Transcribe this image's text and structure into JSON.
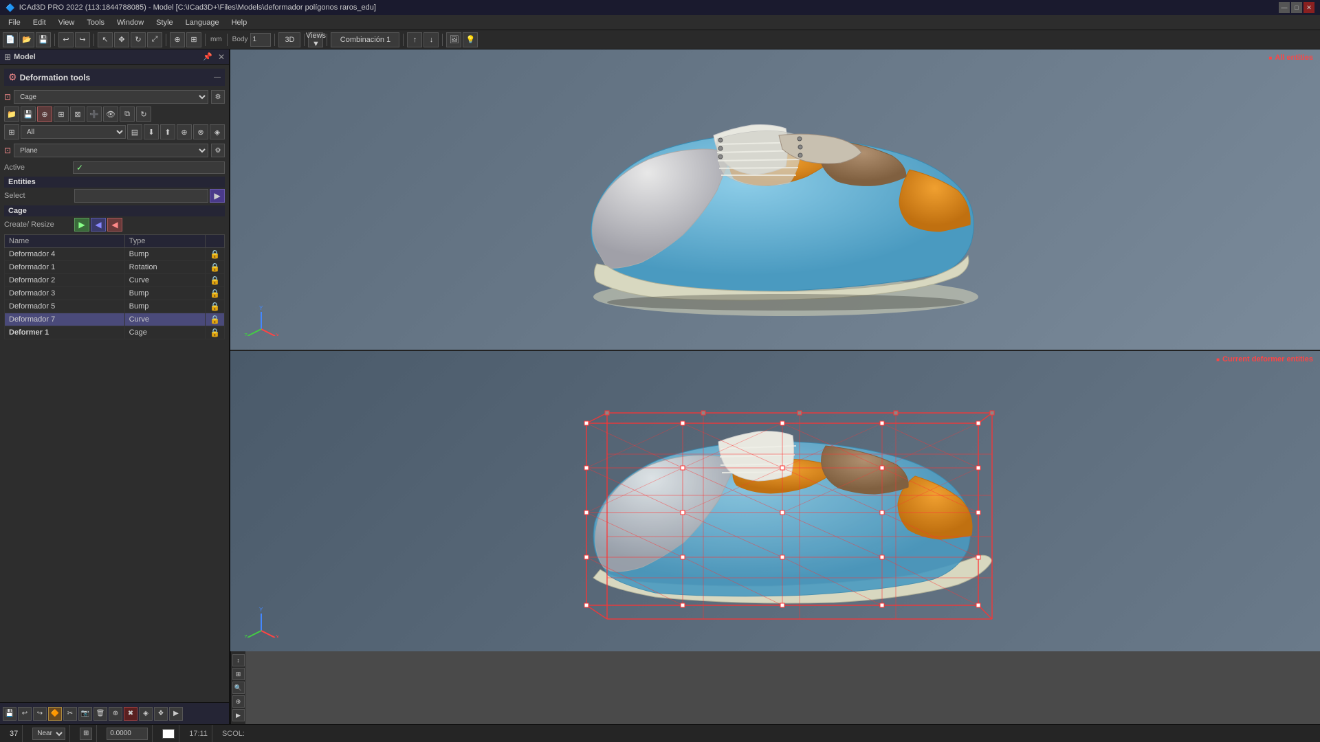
{
  "titlebar": {
    "title": "ICAd3D PRO 2022 (113:1844788085) - Model [C:\\ICad3D+\\Files\\Models\\deformador polígonos raros_edu]",
    "min_label": "—",
    "max_label": "□",
    "close_label": "✕"
  },
  "menubar": {
    "items": [
      "File",
      "Edit",
      "View",
      "Tools",
      "Window",
      "Style",
      "Language",
      "Help"
    ]
  },
  "panel": {
    "title": "Model",
    "pin": "⊞",
    "close": "✕",
    "deformation_tools": "Deformation tools",
    "cage_label": "Cage",
    "plane_label": "Plane",
    "active_label": "Active",
    "active_value": "✓",
    "entities_label": "Entities",
    "select_label": "Select",
    "cage_section": "Cage",
    "create_resize": "Create/ Resize",
    "table": {
      "col_name": "Name",
      "col_type": "Type",
      "rows": [
        {
          "name": "Deformador 4",
          "type": "Bump",
          "selected": false
        },
        {
          "name": "Deformador 1",
          "type": "Rotation",
          "selected": false
        },
        {
          "name": "Deformador 2",
          "type": "Curve",
          "selected": false
        },
        {
          "name": "Deformador 3",
          "type": "Bump",
          "selected": false
        },
        {
          "name": "Deformador 5",
          "type": "Bump",
          "selected": false
        },
        {
          "name": "Deformador 7",
          "type": "Curve",
          "selected": true
        },
        {
          "name": "Deformer 1",
          "type": "Cage",
          "selected": false,
          "bold": true
        }
      ]
    }
  },
  "viewport": {
    "top_label": "All entities",
    "bottom_label": "Current deformer entities"
  },
  "statusbar": {
    "value1": "37",
    "near_label": "Near",
    "coord": "0.0000",
    "time": "17:11",
    "scol": "SCOL:"
  },
  "toolbar": {
    "body_label": "Body",
    "body_value": "1",
    "view_3d": "3D",
    "views_label": "Views",
    "combo_label": "Combinación 1",
    "mm_label": "mm"
  }
}
